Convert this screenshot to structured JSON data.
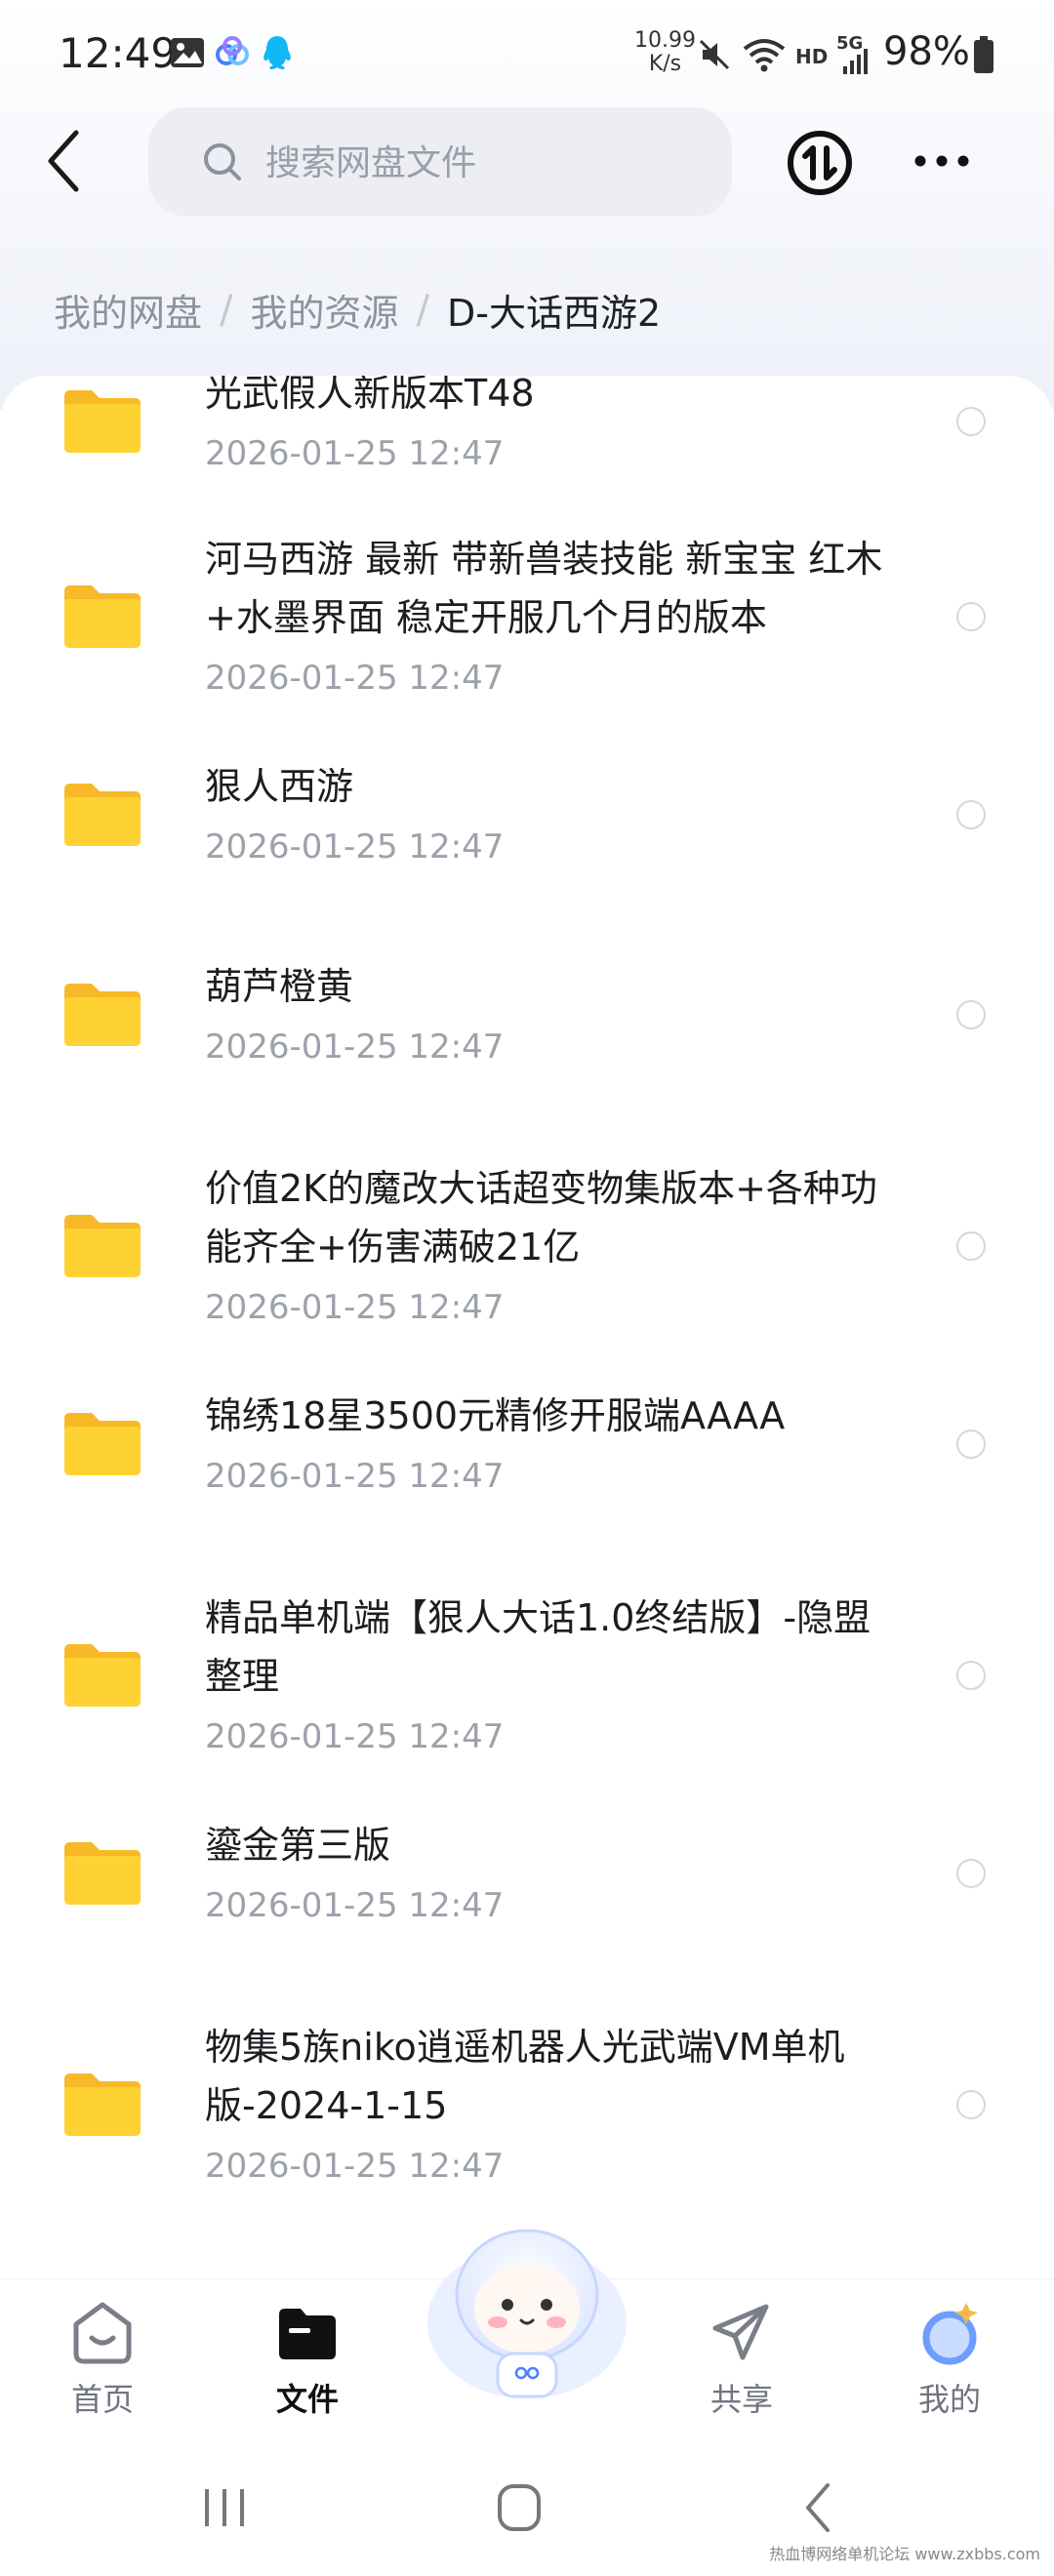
{
  "status_bar": {
    "time": "12:49",
    "speed_value": "10.99",
    "speed_unit": "K/s",
    "hd": "HD",
    "network": "5G",
    "battery": "98%"
  },
  "header": {
    "search_placeholder": "搜索网盘文件"
  },
  "breadcrumb": {
    "items": [
      "我的网盘",
      "我的资源",
      "D-大话西游2"
    ],
    "separator": "/"
  },
  "files": [
    {
      "name": "光武假人新版本T48",
      "date": "2026-01-25  12:47"
    },
    {
      "name": "河马西游 最新 带新兽装技能 新宝宝 红木+水墨界面 稳定开服几个月的版本",
      "date": "2026-01-25  12:47"
    },
    {
      "name": "狠人西游",
      "date": "2026-01-25  12:47"
    },
    {
      "name": "葫芦橙黄",
      "date": "2026-01-25  12:47"
    },
    {
      "name": "价值2K的魔改大话超变物集版本+各种功能齐全+伤害满破21亿",
      "date": "2026-01-25  12:47"
    },
    {
      "name": "锦绣18星3500元精修开服端AAAA",
      "date": "2026-01-25  12:47"
    },
    {
      "name": "精品单机端【狠人大话1.0终结版】-隐盟整理",
      "date": "2026-01-25  12:47"
    },
    {
      "name": "鎏金第三版",
      "date": "2026-01-25  12:47"
    },
    {
      "name": "物集5族niko逍遥机器人光武端VM单机版-2024-1-15",
      "date": "2026-01-25  12:47"
    }
  ],
  "bottom_nav": {
    "home": "首页",
    "files": "文件",
    "share": "共享",
    "me": "我的"
  },
  "watermark": "热血博网络单机论坛 www.zxbbs.com",
  "colors": {
    "folder": "#FFD233",
    "accent": "#4A7DFF"
  }
}
